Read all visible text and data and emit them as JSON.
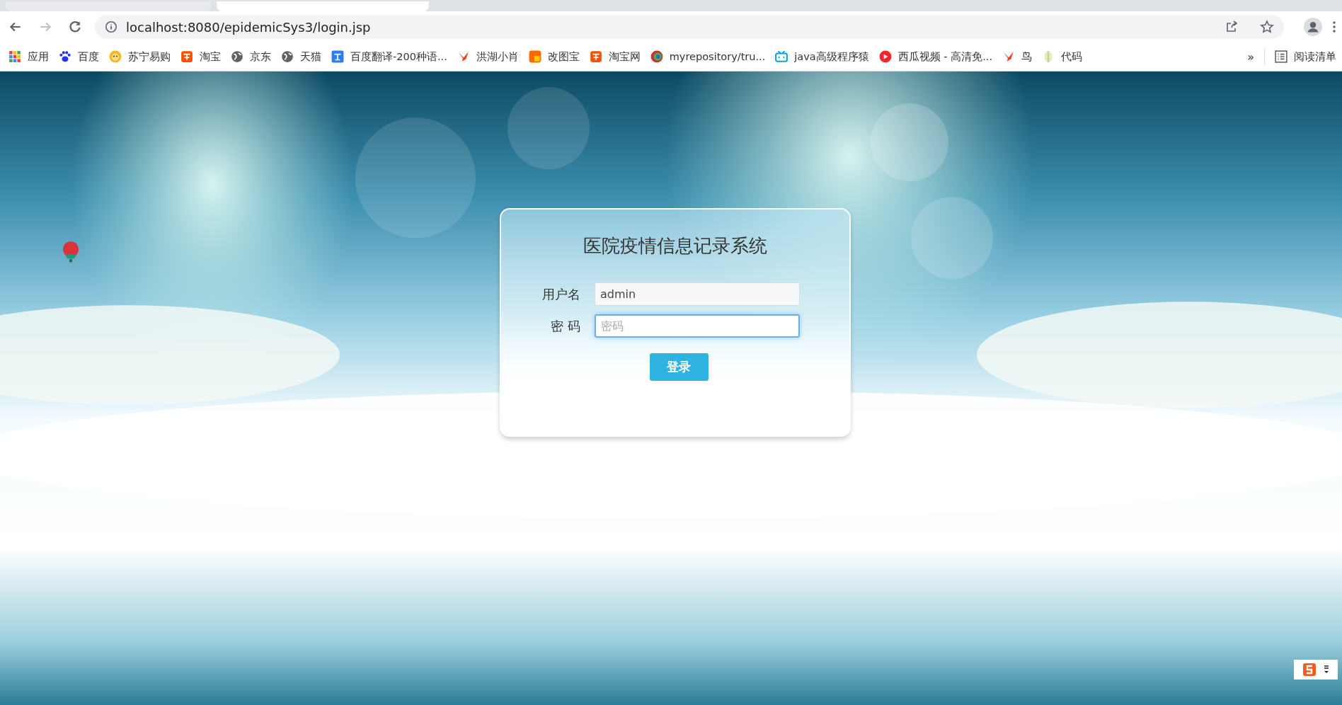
{
  "browser": {
    "address": {
      "host": "localhost",
      "rest": ":8080/epidemicSys3/login.jsp"
    },
    "bookmarks": [
      {
        "label": "应用",
        "kind": "apps"
      },
      {
        "label": "百度",
        "kind": "paw"
      },
      {
        "label": "苏宁易购",
        "kind": "lion"
      },
      {
        "label": "淘宝",
        "kind": "tao"
      },
      {
        "label": "京东",
        "kind": "globe"
      },
      {
        "label": "天猫",
        "kind": "globe"
      },
      {
        "label": "百度翻译-200种语...",
        "kind": "translate"
      },
      {
        "label": "洪湖小肖",
        "kind": "bird"
      },
      {
        "label": "改图宝",
        "kind": "square"
      },
      {
        "label": "淘宝网",
        "kind": "tao"
      },
      {
        "label": "myrepository/tru...",
        "kind": "ring"
      },
      {
        "label": "java高级程序猿",
        "kind": "tv"
      },
      {
        "label": "西瓜视频 - 高清免...",
        "kind": "play"
      },
      {
        "label": "鸟",
        "kind": "bird"
      },
      {
        "label": "代码",
        "kind": "leaf"
      }
    ],
    "more": "»",
    "reading_list": "阅读清单"
  },
  "login": {
    "title": "医院疫情信息记录系统",
    "fields": [
      {
        "label": "用户名",
        "value": "admin",
        "focused": false
      },
      {
        "label": "密 码",
        "placeholder": "密码",
        "focused": true
      }
    ],
    "submit": "登录"
  }
}
